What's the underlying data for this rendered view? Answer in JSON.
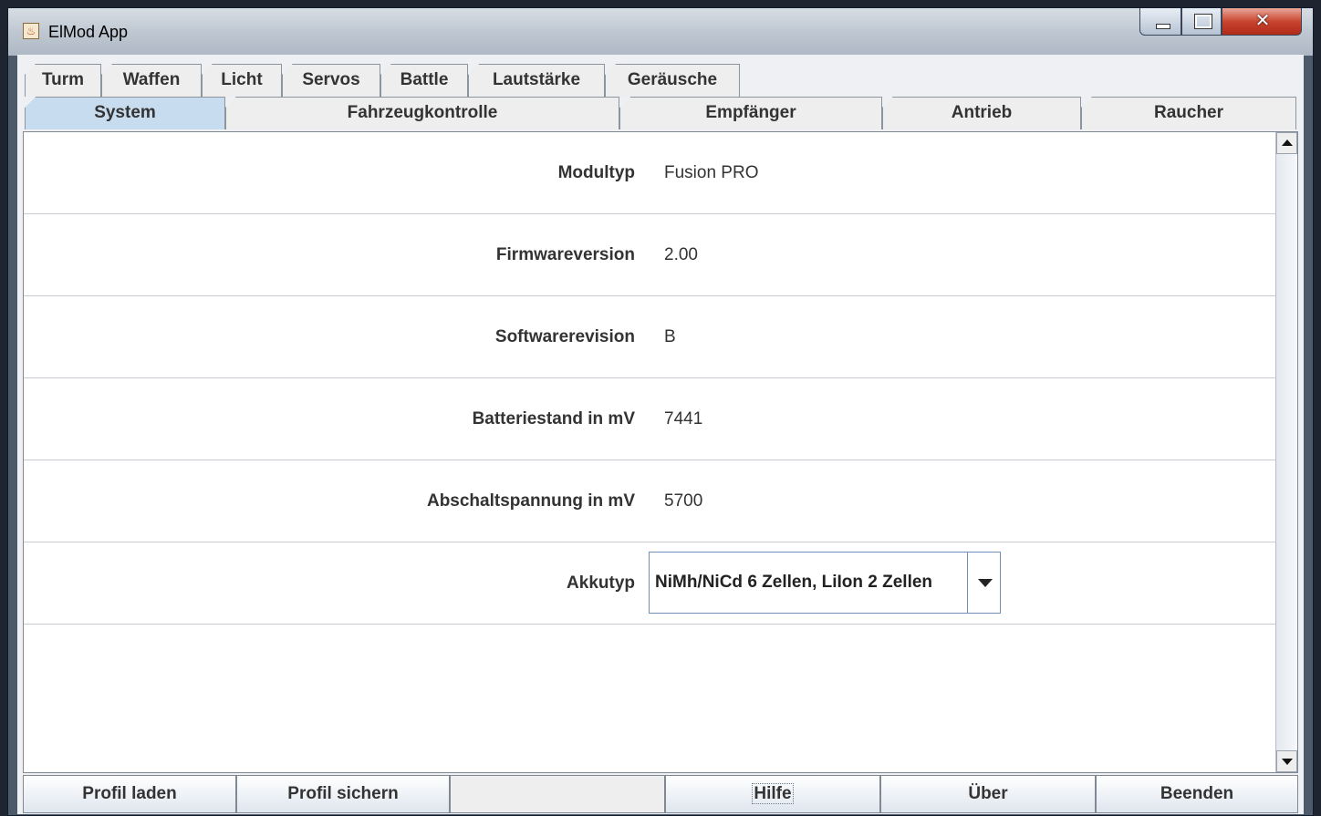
{
  "window": {
    "title": "ElMod App"
  },
  "tabs_row1": [
    "Turm",
    "Waffen",
    "Licht",
    "Servos",
    "Battle",
    "Lautstärke",
    "Geräusche"
  ],
  "tabs_row2": [
    "System",
    "Fahrzeugkontrolle",
    "Empfänger",
    "Antrieb",
    "Raucher"
  ],
  "active_tab": "System",
  "fields": [
    {
      "label": "Modultyp",
      "value": "Fusion PRO"
    },
    {
      "label": "Firmwareversion",
      "value": "2.00"
    },
    {
      "label": "Softwarerevision",
      "value": "B"
    },
    {
      "label": "Batteriestand in mV",
      "value": "7441"
    },
    {
      "label": "Abschaltspannung in mV",
      "value": "5700"
    }
  ],
  "akkutyp": {
    "label": "Akkutyp",
    "selected": "NiMh/NiCd 6 Zellen, LiIon 2 Zellen"
  },
  "buttons": {
    "profil_laden": "Profil laden",
    "profil_sichern": "Profil sichern",
    "hilfe": "Hilfe",
    "ueber": "Über",
    "beenden": "Beenden"
  },
  "icons": {
    "app": "java-coffee-icon",
    "minimize": "minimize-icon",
    "maximize": "maximize-icon",
    "close": "close-icon"
  }
}
